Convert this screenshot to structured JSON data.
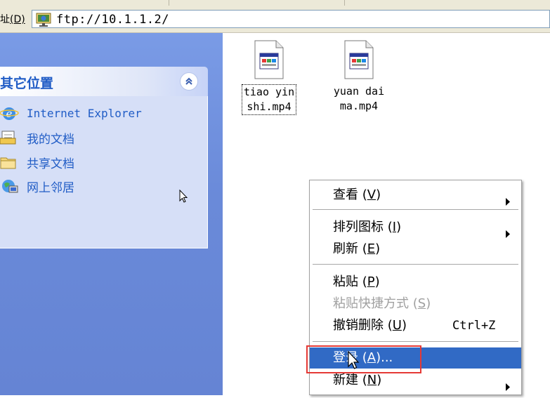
{
  "address_bar": {
    "label_prefix": "址",
    "label_accel": "(D)",
    "icon": "ftp-folder-icon",
    "value": "ftp://10.1.1.2/"
  },
  "task_pane": {
    "other_places": {
      "title": "其它位置",
      "collapse_icon": "double-chevron-up-icon",
      "links": [
        {
          "label": "Internet Explorer",
          "icon": "internet-explorer-icon"
        },
        {
          "label": "我的文档",
          "icon": "my-documents-icon"
        },
        {
          "label": "共享文档",
          "icon": "shared-folder-icon"
        },
        {
          "label": "网上邻居",
          "icon": "network-places-icon"
        }
      ]
    }
  },
  "files": [
    {
      "name_line1": "tiao yin",
      "name_line2": "shi.mp4",
      "icon": "media-file-icon"
    },
    {
      "name_line1": "yuan dai",
      "name_line2": "ma.mp4",
      "icon": "media-file-icon"
    }
  ],
  "context_menu": {
    "items": [
      {
        "label": "查看",
        "accel": "V",
        "submenu": true
      },
      {
        "label": "排列图标",
        "accel": "I",
        "submenu": true
      },
      {
        "label": "刷新",
        "accel": "E"
      },
      {
        "label": "粘贴",
        "accel": "P"
      },
      {
        "label": "粘贴快捷方式",
        "accel": "S",
        "disabled": true
      },
      {
        "label": "撤销删除",
        "accel": "U",
        "shortcut": "Ctrl+Z"
      },
      {
        "label": "登录",
        "accel": "A",
        "suffix": "...",
        "highlighted": true
      },
      {
        "label": "新建",
        "accel": "N",
        "submenu": true
      }
    ]
  },
  "colors": {
    "pane_blue": "#6a8ad9",
    "panel_title": "#215dc6",
    "menu_highlight": "#316ac5",
    "annotation_red": "#e53935"
  }
}
